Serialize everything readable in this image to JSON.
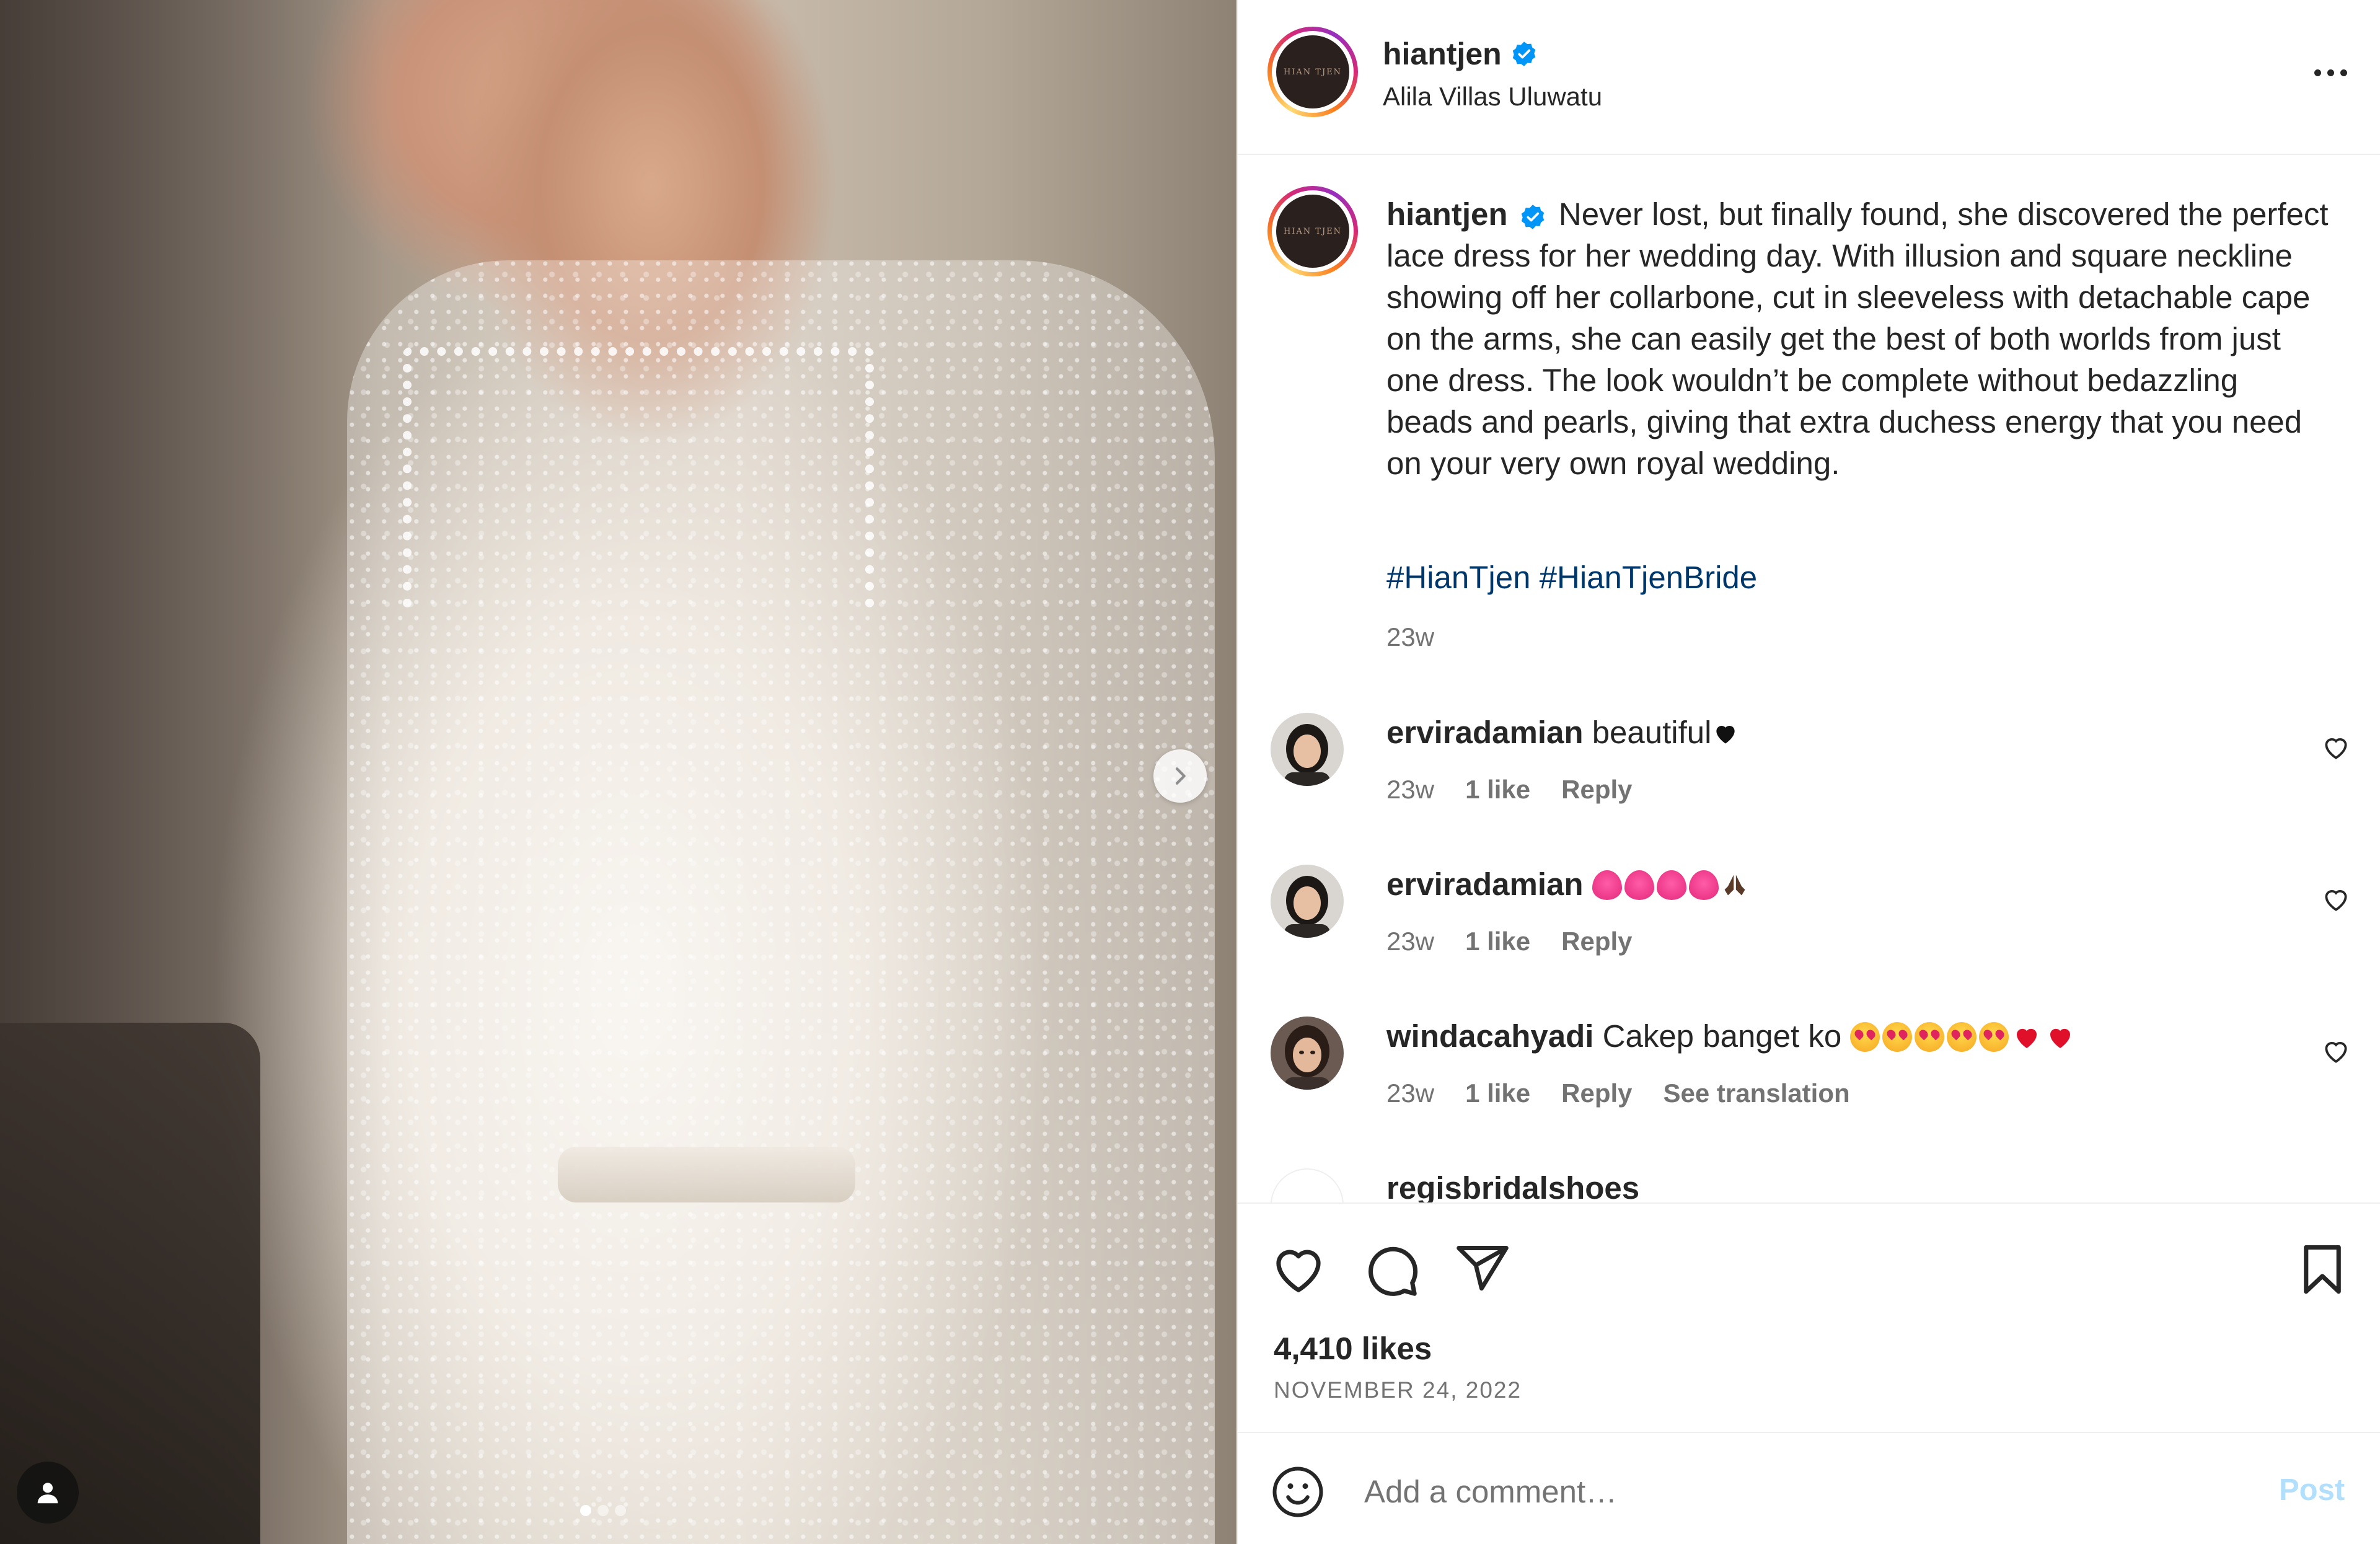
{
  "header": {
    "username": "hiantjen",
    "location": "Alila Villas Uluwatu",
    "logo_text": "HIAN TJEN"
  },
  "caption": {
    "username": "hiantjen",
    "text": "Never lost, but finally found, she discovered the perfect lace dress for her wedding day. With illusion and square neckline showing off her collarbone, cut in sleeveless with detachable cape on the arms, she can easily get the best of both worlds from just one dress. The look wouldn’t be complete without bedazzling beads and pearls, giving that extra duchess energy that you need on your very own royal wedding.",
    "hashtags": [
      "#HianTjen",
      "#HianTjenBride"
    ],
    "time": "23w"
  },
  "comments": [
    {
      "username": "erviradamian",
      "text": "beautiful",
      "emoji": [
        "black-heart"
      ],
      "time": "23w",
      "likes": "1 like",
      "reply": "Reply"
    },
    {
      "username": "erviradamian",
      "text": "",
      "emoji": [
        "pink-heart",
        "pink-heart",
        "pink-heart",
        "pink-heart",
        "folded-hands"
      ],
      "time": "23w",
      "likes": "1 like",
      "reply": "Reply"
    },
    {
      "username": "windacahyadi",
      "text": "Cakep banget ko",
      "emoji": [
        "heart-eyes",
        "heart-eyes",
        "heart-eyes",
        "heart-eyes",
        "heart-eyes",
        "red-heart",
        "red-heart"
      ],
      "time": "23w",
      "likes": "1 like",
      "reply": "Reply",
      "translate": "See translation"
    }
  ],
  "partial_comment": {
    "username": "regisbridalshoes"
  },
  "actions": {
    "likes": "4,410 likes",
    "date": "NOVEMBER 24, 2022"
  },
  "add_comment": {
    "placeholder": "Add a comment…",
    "post_label": "Post"
  },
  "carousel": {
    "current": 1,
    "total": 3
  },
  "colors": {
    "text": "#262626",
    "secondary": "#737373",
    "link": "#00376b",
    "verified": "#0095f6",
    "post_disabled": "#b2dffc"
  },
  "icons": [
    "more-icon",
    "verified-icon",
    "heart-icon",
    "comment-icon",
    "share-icon",
    "bookmark-icon",
    "emoji-icon",
    "user-tag-icon",
    "chevron-right-icon"
  ]
}
